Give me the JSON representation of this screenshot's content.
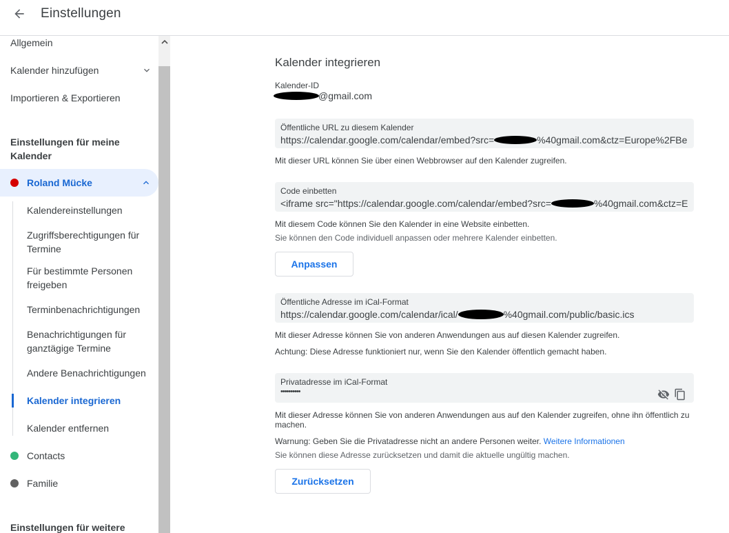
{
  "header": {
    "title": "Einstellungen"
  },
  "sidebar": {
    "top_items": [
      {
        "label": "Allgemein"
      },
      {
        "label": "Kalender hinzufügen"
      },
      {
        "label": "Importieren & Exportieren"
      }
    ],
    "my_calendars_heading": "Einstellungen für meine Kalender",
    "active_calendar": {
      "name": "Roland Mücke",
      "color": "#d50000"
    },
    "sub_items": [
      {
        "label": "Kalendereinstellungen"
      },
      {
        "label": "Zugriffsberechtigungen für Termine"
      },
      {
        "label": "Für bestimmte Personen freigeben"
      },
      {
        "label": "Terminbenachrichtigungen"
      },
      {
        "label": "Benachrichtigungen für ganztägige Termine"
      },
      {
        "label": "Andere Benachrichtigungen"
      },
      {
        "label": "Kalender integrieren"
      },
      {
        "label": "Kalender entfernen"
      }
    ],
    "other_calendars": [
      {
        "name": "Contacts",
        "color": "#33b679"
      },
      {
        "name": "Familie",
        "color": "#616161"
      }
    ],
    "other_heading": "Einstellungen für weitere"
  },
  "main": {
    "title": "Kalender integrieren",
    "calendar_id": {
      "label": "Kalender-ID",
      "value": "@gmail.com"
    },
    "public_url": {
      "label": "Öffentliche URL zu diesem Kalender",
      "prefix": "https://calendar.google.com/calendar/embed?src=",
      "suffix": "%40gmail.com&ctz=Europe%2FBe",
      "help": "Mit dieser URL können Sie über einen Webbrowser auf den Kalender zugreifen."
    },
    "embed_code": {
      "label": "Code einbetten",
      "prefix": "<iframe src=\"https://calendar.google.com/calendar/embed?src=",
      "suffix": "%40gmail.com&ctz=E",
      "help1": "Mit diesem Code können Sie den Kalender in eine Website einbetten.",
      "help2": "Sie können den Code individuell anpassen oder mehrere Kalender einbetten.",
      "button": "Anpassen"
    },
    "ical_public": {
      "label": "Öffentliche Adresse im iCal-Format",
      "prefix": "https://calendar.google.com/calendar/ical/",
      "suffix": "%40gmail.com/public/basic.ics",
      "help1": "Mit dieser Adresse können Sie von anderen Anwendungen aus auf diesen Kalender zugreifen.",
      "help2": "Achtung: Diese Adresse funktioniert nur, wenn Sie den Kalender öffentlich gemacht haben."
    },
    "ical_private": {
      "label": "Privatadresse im iCal-Format",
      "value": "••••••••••",
      "help1": "Mit dieser Adresse können Sie von anderen Anwendungen aus auf den Kalender zugreifen, ohne ihn öffentlich zu machen.",
      "warning": "Warnung: Geben Sie die Privatadresse nicht an andere Personen weiter.",
      "warning_link": "Weitere Informationen",
      "help3": "Sie können diese Adresse zurücksetzen und damit die aktuelle ungültig machen.",
      "button": "Zurücksetzen"
    }
  },
  "colors": {
    "accent": "#1a73e8",
    "active_bg": "#e8f0fe",
    "field_bg": "#f1f3f4"
  }
}
